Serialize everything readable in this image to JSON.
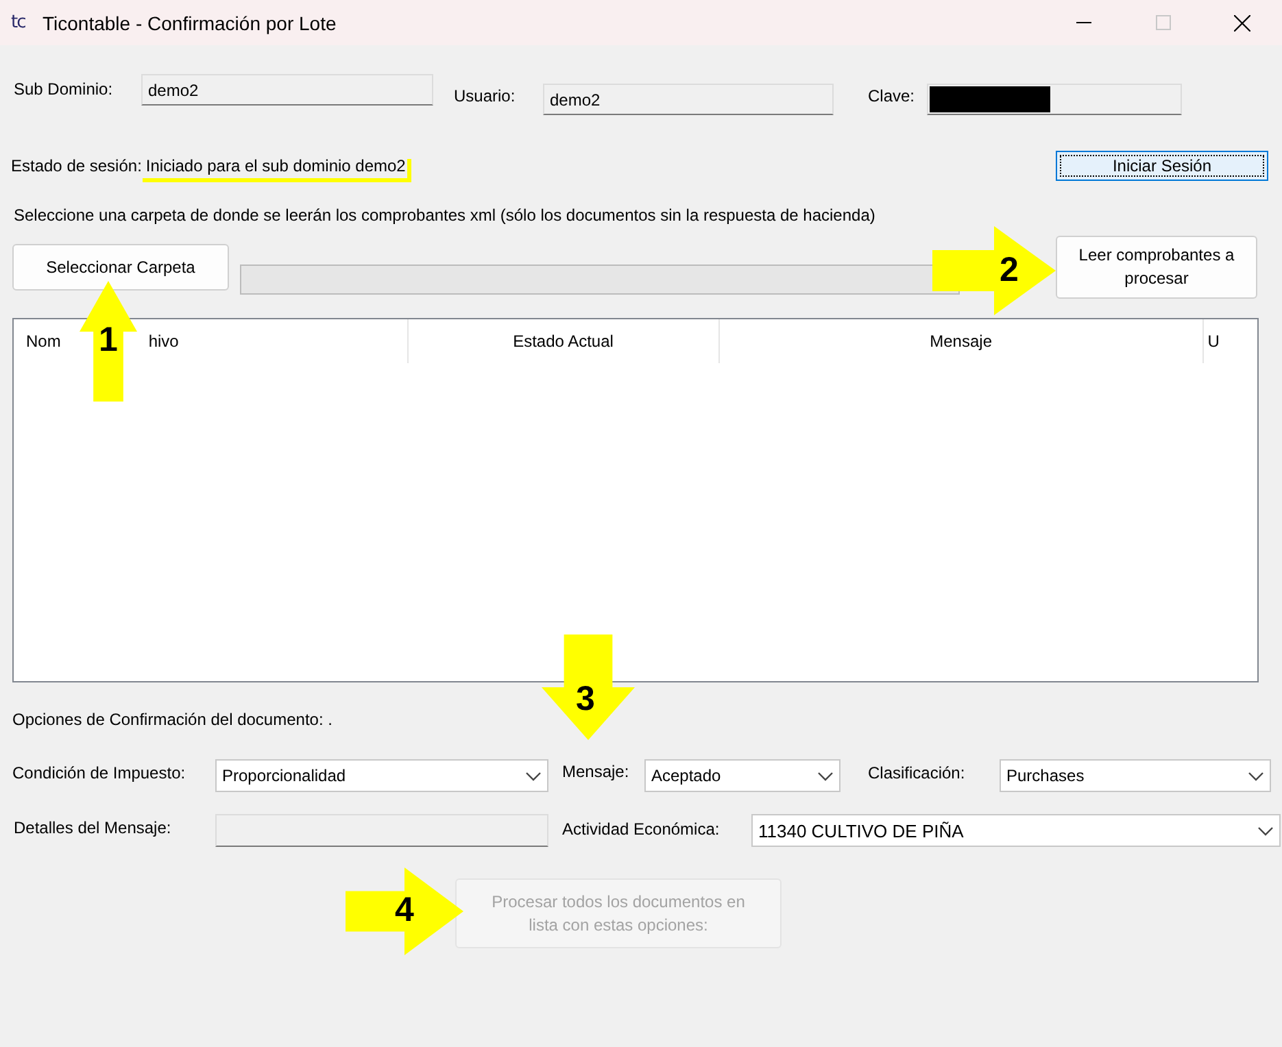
{
  "window": {
    "icon_text": "tc",
    "title": "Ticontable - Confirmación por Lote"
  },
  "login": {
    "fields": [
      {
        "label": "Sub Dominio:",
        "value": "demo2"
      },
      {
        "label": "Usuario:",
        "value": "demo2"
      },
      {
        "label": "Clave:",
        "masked": true
      }
    ],
    "session_label": "Estado de sesión:",
    "session_status": "Iniciado para el sub dominio demo2",
    "status_underlined": true,
    "login_button": "Iniciar Sesión"
  },
  "instruction": "Seleccione una carpeta de donde se leerán los comprobantes xml (sólo los documentos sin la respuesta de hacienda)",
  "select_folder_button": "Seleccionar Carpeta",
  "progress": {
    "level": 0
  },
  "read_button": "Leer comprobantes a procesar",
  "table": {
    "columns": [
      {
        "parts": [
          "Nom",
          "hivo"
        ]
      },
      {
        "parts": [
          "Estado Actual"
        ]
      },
      {
        "parts": [
          "Mensaje"
        ]
      },
      {
        "parts": [
          "U"
        ]
      }
    ]
  },
  "options_title": "Opciones de Confirmación del documento: .",
  "options": {
    "tax_condition": {
      "label": "Condición de Impuesto:",
      "value": "Proporcionalidad"
    },
    "message": {
      "label": "Mensaje:",
      "value": "Aceptado"
    },
    "classification": {
      "label": "Clasificación:",
      "value": "Purchases"
    },
    "message_details": {
      "label": "Detalles del Mensaje:",
      "disabled": true
    },
    "activity": {
      "label": "Actividad Económica:",
      "value": "11340 CULTIVO DE PIÑA"
    }
  },
  "process_button": {
    "label": "Procesar todos los documentos en lista con estas opciones:",
    "disabled": true
  },
  "annotations": [
    {
      "number": "1"
    },
    {
      "number": "2"
    },
    {
      "number": "3"
    },
    {
      "number": "4"
    }
  ]
}
